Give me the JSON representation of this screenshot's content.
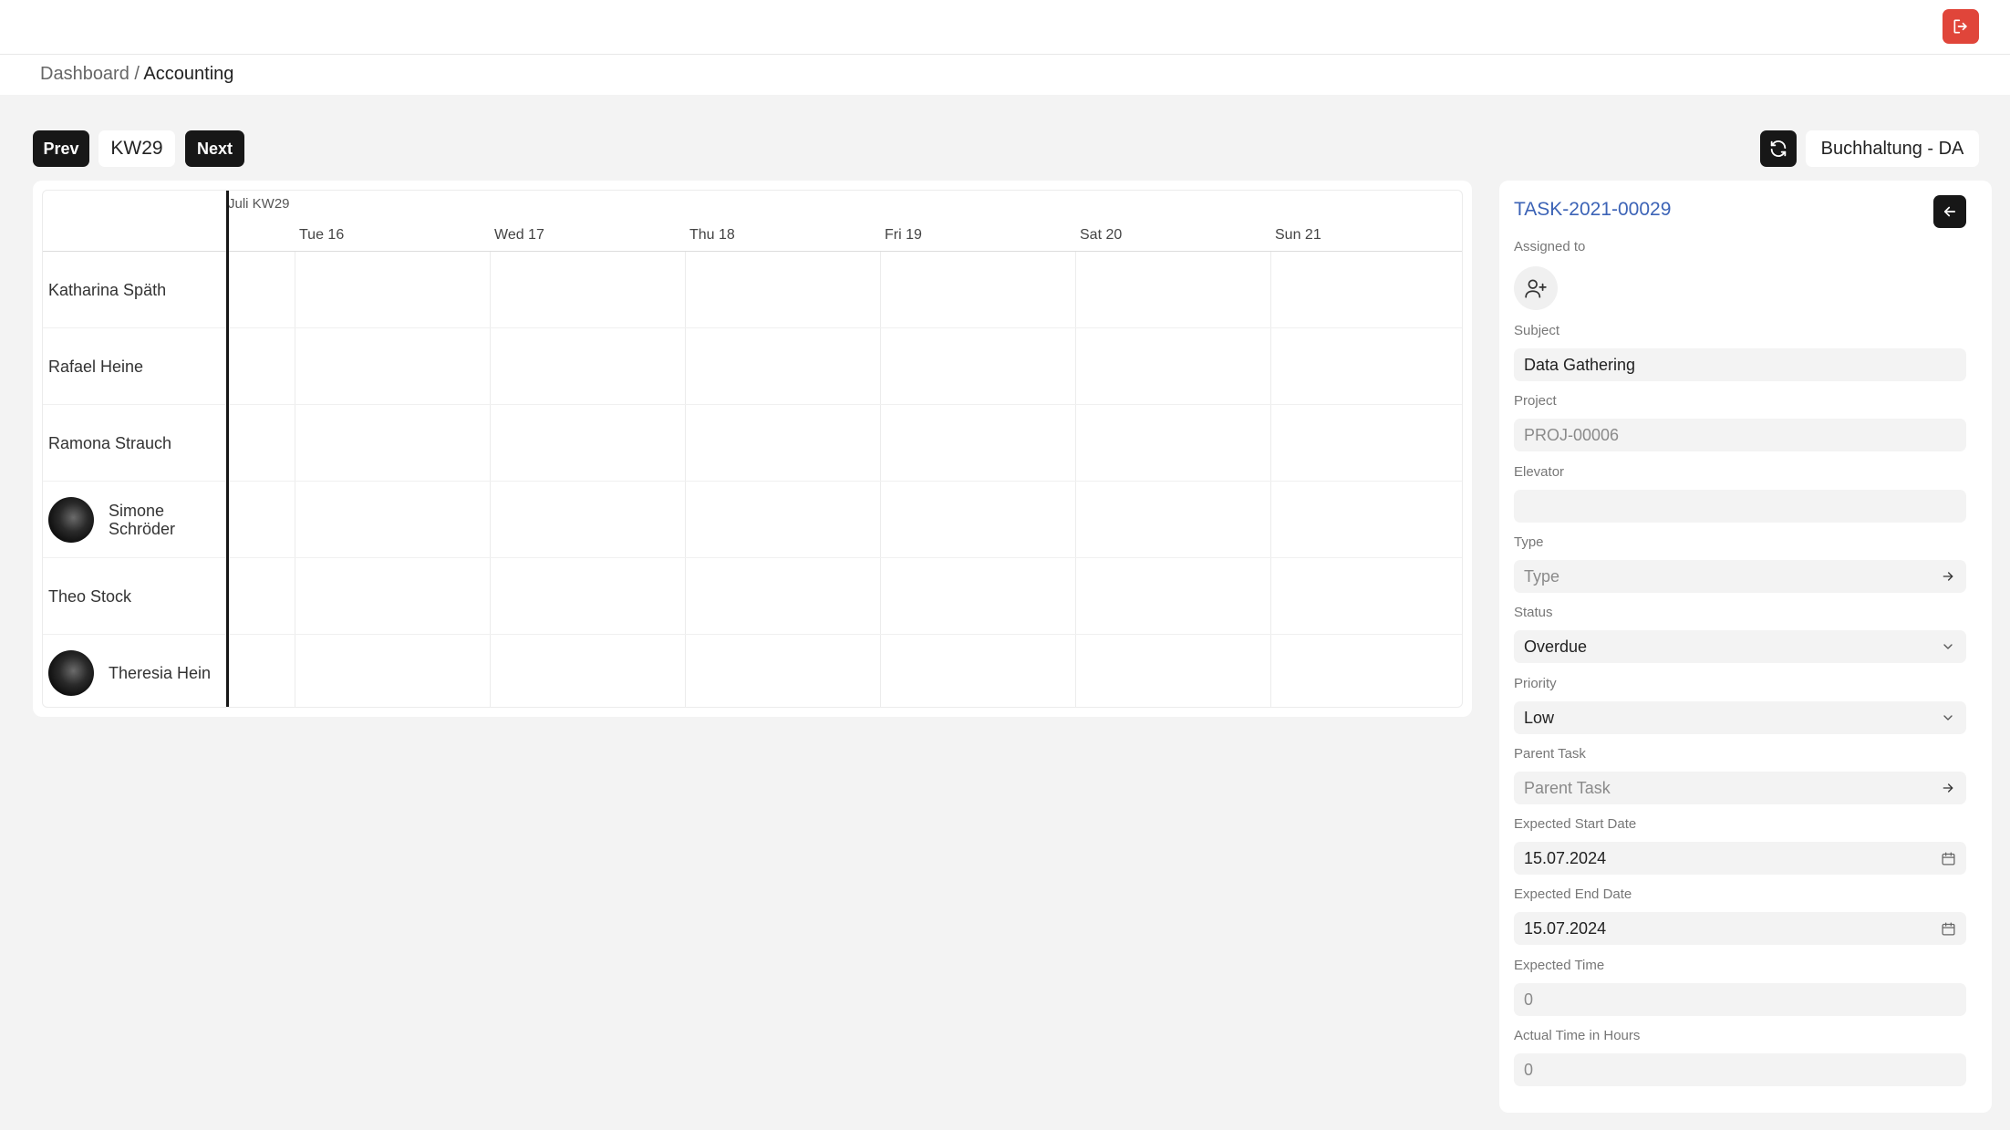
{
  "breadcrumb": {
    "root": "Dashboard",
    "separator": " / ",
    "current": "Accounting"
  },
  "nav": {
    "prev_label": "Prev",
    "week_label": "KW29",
    "next_label": "Next"
  },
  "department": "Buchhaltung - DA",
  "calendar": {
    "month_label": "Juli KW29",
    "days": [
      "Tue 16",
      "Wed 17",
      "Thu 18",
      "Fri 19",
      "Sat 20",
      "Sun 21"
    ],
    "rows": [
      {
        "name": "Katharina Späth",
        "has_avatar": false
      },
      {
        "name": "Rafael Heine",
        "has_avatar": false
      },
      {
        "name": "Ramona Strauch",
        "has_avatar": false
      },
      {
        "name": "Simone Schröder",
        "name_line1": "Simone",
        "name_line2": "Schröder",
        "has_avatar": true
      },
      {
        "name": "Theo Stock",
        "has_avatar": false
      },
      {
        "name": "Theresia Hein",
        "has_avatar": true
      }
    ]
  },
  "task": {
    "id": "TASK-2021-00029",
    "assigned_label": "Assigned to",
    "subject_label": "Subject",
    "subject_value": "Data Gathering",
    "project_label": "Project",
    "project_value": "PROJ-00006",
    "elevator_label": "Elevator",
    "elevator_value": "",
    "type_label": "Type",
    "type_placeholder": "Type",
    "status_label": "Status",
    "status_value": "Overdue",
    "priority_label": "Priority",
    "priority_value": "Low",
    "parent_label": "Parent Task",
    "parent_placeholder": "Parent Task",
    "start_label": "Expected Start Date",
    "start_value": "15.07.2024",
    "end_label": "Expected End Date",
    "end_value": "15.07.2024",
    "exp_time_label": "Expected Time",
    "exp_time_value": "0",
    "actual_label": "Actual Time in Hours",
    "actual_value": "0"
  },
  "icons": {
    "logout": "logout-icon",
    "refresh": "refresh-icon",
    "back": "arrow-left-icon",
    "assign": "add-user-icon",
    "arrow": "arrow-right-icon",
    "chevron": "chevron-down-icon",
    "calendar": "calendar-icon"
  },
  "colors": {
    "accent_red": "#e0453a",
    "dark": "#171717",
    "link_blue": "#3c63b6",
    "field_bg": "#f3f3f3"
  }
}
